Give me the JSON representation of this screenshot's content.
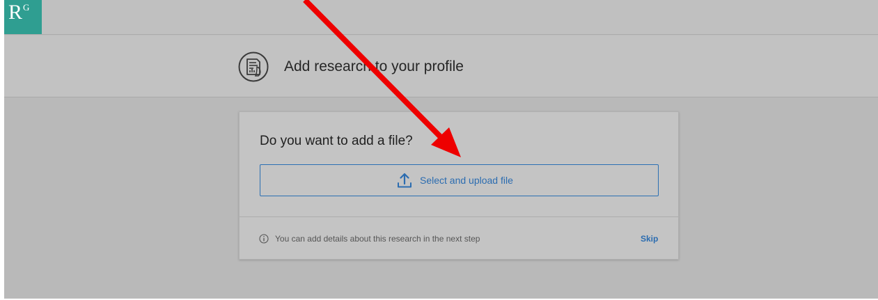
{
  "logo": {
    "main": "R",
    "superscript": "G"
  },
  "header": {
    "icon": "research-document-icon",
    "title": "Add research to your profile"
  },
  "card": {
    "question": "Do you want to add a file?",
    "upload_button": {
      "icon": "upload-icon",
      "label": "Select and upload file"
    },
    "footer": {
      "info_icon": "info-icon",
      "text": "You can add details about this research in the next step",
      "skip_label": "Skip"
    }
  },
  "colors": {
    "logo_bg": "#2f9e91",
    "accent_blue": "#2b6cb0",
    "annotation_arrow": "#ee0000"
  }
}
